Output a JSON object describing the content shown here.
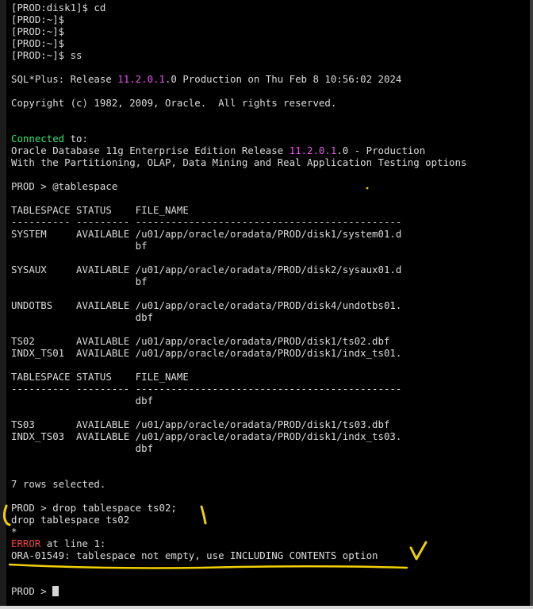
{
  "terminal": {
    "lines": {
      "l1": "[PROD:disk1]$ cd",
      "l2": "[PROD:~]$",
      "l3": "[PROD:~]$",
      "l4": "[PROD:~]$",
      "l5": "[PROD:~]$ ss",
      "banner_a": "SQL*Plus: Release ",
      "banner_ver": "11.2.0.1",
      "banner_b": ".0 Production on Thu Feb 8 10:56:02 2024",
      "copyright": "Copyright (c) 1982, 2009, Oracle.  All rights reserved.",
      "connected_word": "Connected",
      "connected_rest": " to:",
      "db_a": "Oracle Database 11g Enterprise Edition Release ",
      "db_ver": "11.2.0.1",
      "db_b": ".0 - Production",
      "options": "With the Partitioning, OLAP, Data Mining and Real Application Testing options",
      "prompt_ts": "PROD > @tablespace",
      "header1": "TABLESPACE STATUS    FILE_NAME",
      "dashes1": "---------- --------- ---------------------------------------------",
      "r1a": "SYSTEM     AVAILABLE /u01/app/oracle/oradata/PROD/disk1/system01.d",
      "r1b": "                     bf",
      "r2a": "SYSAUX     AVAILABLE /u01/app/oracle/oradata/PROD/disk2/sysaux01.d",
      "r2b": "                     bf",
      "r3a": "UNDOTBS    AVAILABLE /u01/app/oracle/oradata/PROD/disk4/undotbs01.",
      "r3b": "                     dbf",
      "r4": "TS02       AVAILABLE /u01/app/oracle/oradata/PROD/disk1/ts02.dbf",
      "r5": "INDX_TS01  AVAILABLE /u01/app/oracle/oradata/PROD/disk1/indx_ts01.",
      "header2": "TABLESPACE STATUS    FILE_NAME",
      "dashes2": "---------- --------- ---------------------------------------------",
      "r5b": "                     dbf",
      "r6": "TS03       AVAILABLE /u01/app/oracle/oradata/PROD/disk1/ts03.dbf",
      "r7a": "INDX_TS03  AVAILABLE /u01/app/oracle/oradata/PROD/disk1/indx_ts03.",
      "r7b": "                     dbf",
      "rows_selected": "7 rows selected.",
      "drop_cmd": "PROD > drop tablespace ts02;",
      "drop_echo": "drop tablespace ts02",
      "star": "*",
      "error_word": "ERROR",
      "error_rest": " at line 1:",
      "ora_error": "ORA-01549: tablespace not empty, use INCLUDING CONTENTS option",
      "final_prompt": "PROD > "
    },
    "colors": {
      "background": "#000000",
      "text": "#dcdcdc",
      "version_magenta": "#e256e8",
      "connected_green": "#2ee66c",
      "error_red": "#f0453d",
      "annotation_yellow": "#f2d000"
    }
  }
}
